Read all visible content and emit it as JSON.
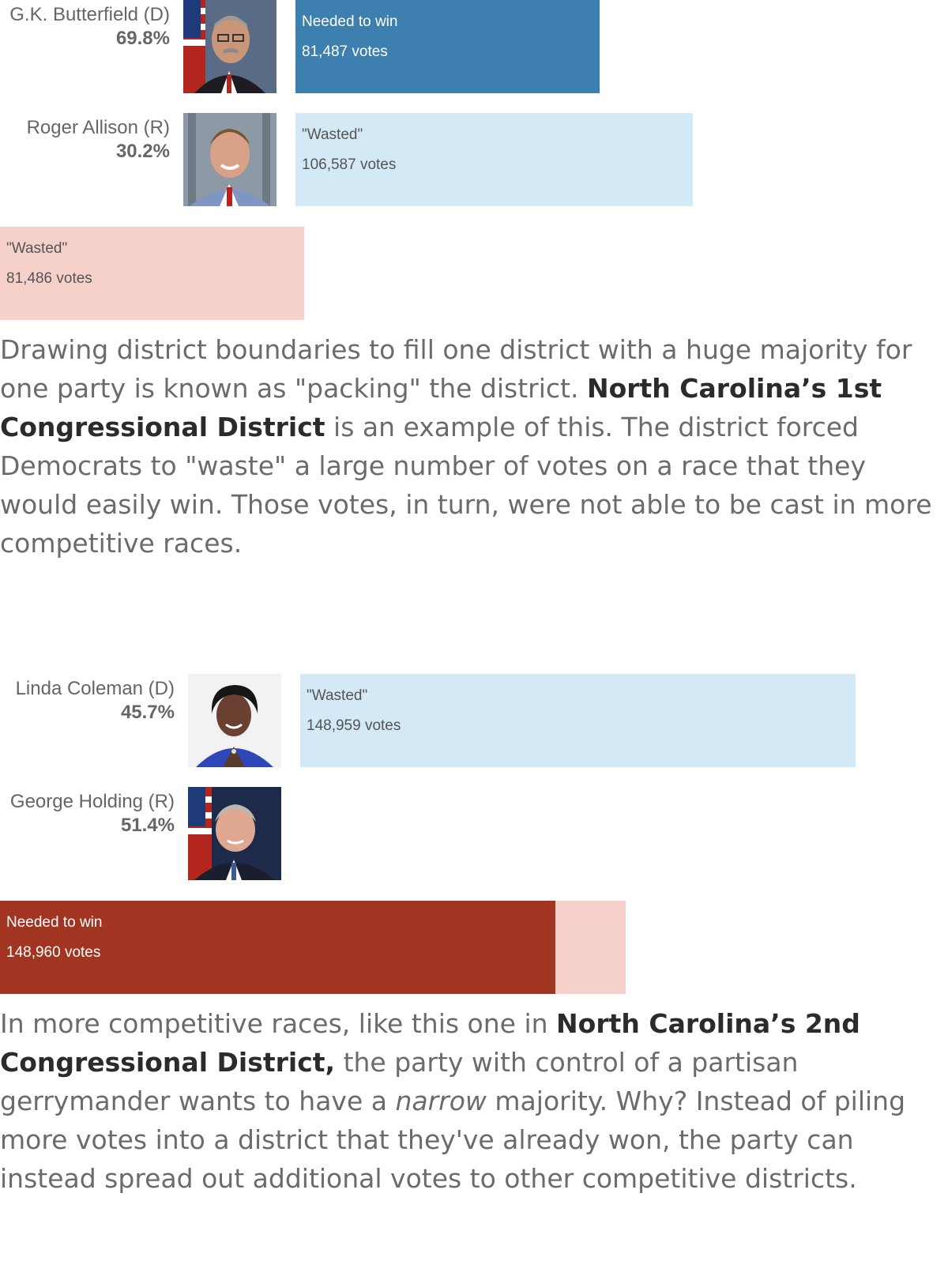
{
  "chart_data": [
    {
      "type": "bar",
      "scale_max": 160000,
      "candidates": [
        {
          "name": "G.K. Butterfield (D)",
          "pct": "69.8%",
          "party": "D"
        },
        {
          "name": "Roger Allison (R)",
          "pct": "30.2%",
          "party": "R"
        }
      ],
      "bars": [
        {
          "label": "Needed to win",
          "value": 81487,
          "value_text": "81,487 votes",
          "color": "#3d7fae",
          "text_color": "#ffffff"
        },
        {
          "label": "\"Wasted\"",
          "value": 106587,
          "value_text": "106,587 votes",
          "color": "#d3e9f6",
          "text_color": "#555555"
        },
        {
          "label": "\"Wasted\"",
          "value": 81486,
          "value_text": "81,486 votes",
          "color": "#f6d0ca",
          "text_color": "#555555"
        }
      ]
    },
    {
      "type": "bar",
      "scale_max": 160000,
      "candidates": [
        {
          "name": "Linda Coleman (D)",
          "pct": "45.7%",
          "party": "D"
        },
        {
          "name": "George Holding (R)",
          "pct": "51.4%",
          "party": "R"
        }
      ],
      "bars": [
        {
          "label": "\"Wasted\"",
          "value": 148959,
          "value_text": "148,959 votes",
          "color": "#d3e9f6",
          "text_color": "#555555"
        },
        {
          "label": "Needed to win",
          "value": 148960,
          "value_text": "148,960 votes",
          "color": "#a23522",
          "text_color": "#ffffff",
          "surplus_value": 18900,
          "surplus_color": "#f6d0ca"
        }
      ]
    }
  ],
  "paragraphs": {
    "p1": {
      "t1": "Drawing district boundaries to fill one district with a huge majority for one party is known as \"packing\" the district. ",
      "b1": "North Carolina’s 1st Congressional District",
      "t2": " is an example of this. The district forced Democrats to \"waste\" a large number of votes on a race that they would easily win. Those votes, in turn, were not able to be cast in more competitive races."
    },
    "p2": {
      "t1": "In more competitive races, like this one in ",
      "b1": "North Carolina’s 2nd Congressional District,",
      "t2": " the party with control of a partisan gerrymander wants to have a ",
      "i1": "narrow",
      "t3": " majority. Why? Instead of piling more votes into a district that they've already won, the party can instead spread out additional votes to other competitive districts."
    }
  }
}
